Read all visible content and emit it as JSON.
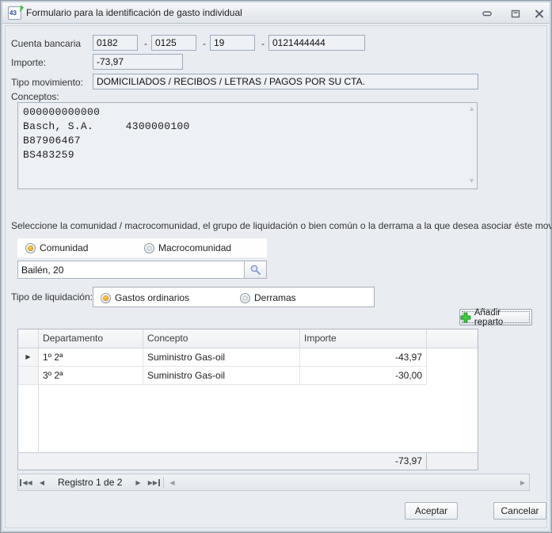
{
  "window": {
    "title": "Formulario para la identificación de gasto individual",
    "icon_text": "43"
  },
  "account": {
    "label": "Cuenta bancaria",
    "separator": "-",
    "fields": [
      "0182",
      "0125",
      "19",
      "0121444444"
    ]
  },
  "importe": {
    "label": "Importe:",
    "value": "-73,97"
  },
  "tipo_movimiento": {
    "label": "Tipo movimiento:",
    "value": "DOMICILIADOS / RECIBOS / LETRAS / PAGOS POR SU CTA."
  },
  "conceptos": {
    "label": "Conceptos:",
    "text": "000000000000\nBasch, S.A.     4300000100\nB87906467\nBS483259"
  },
  "seleccion": {
    "instruction": "Seleccione la comunidad / macrocomunidad, el grupo de liquidación o bien común o la derrama a la que desea asociar éste movimiento.",
    "option_comunidad": "Comunidad",
    "option_macrocomunidad": "Macrocomunidad",
    "selected": "Comunidad",
    "search_value": "Bailén, 20"
  },
  "liquidacion": {
    "label": "Tipo de liquidación:",
    "option_ordinarios": "Gastos ordinarios",
    "option_derramas": "Derramas",
    "selected": "Gastos ordinarios"
  },
  "toolbar": {
    "add_reparto_label": "Añadir reparto"
  },
  "grid": {
    "columns": {
      "departamento": "Departamento",
      "concepto": "Concepto",
      "importe": "Importe"
    },
    "rows": [
      {
        "departamento": "1º 2ª",
        "concepto": "Suministro Gas-oil",
        "importe": "-43,97"
      },
      {
        "departamento": "3º 2ª",
        "concepto": "Suministro Gas-oil",
        "importe": "-30,00"
      }
    ],
    "summary_total": "-73,97",
    "navigator_label": "Registro 1 de 2"
  },
  "footer": {
    "accept_label": "Aceptar",
    "cancel_label": "Cancelar"
  },
  "colors": {
    "accent-orange": "#f59b00",
    "accent-green": "#3ecf3e",
    "dialog-bg": "#e9edf2"
  }
}
